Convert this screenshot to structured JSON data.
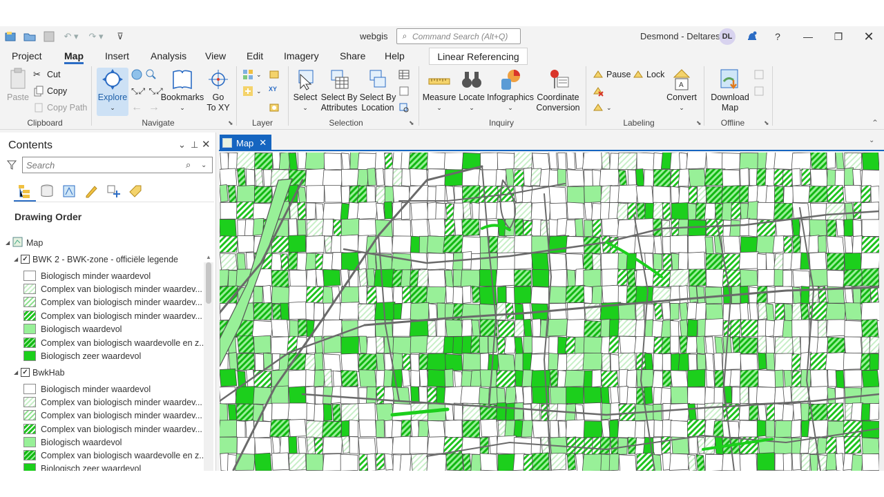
{
  "titlebar": {
    "app_title": "webgis",
    "command_search_placeholder": "Command Search (Alt+Q)",
    "user_name": "Desmond - Deltares",
    "avatar_initials": "DL",
    "help_label": "?"
  },
  "tabs": [
    "Project",
    "Map",
    "Insert",
    "Analysis",
    "View",
    "Edit",
    "Imagery",
    "Share",
    "Help"
  ],
  "contextual_tab": "Linear Referencing",
  "ribbon": {
    "clipboard": {
      "paste": "Paste",
      "cut": "Cut",
      "copy": "Copy",
      "copy_path": "Copy Path",
      "label": "Clipboard"
    },
    "navigate": {
      "explore": "Explore",
      "bookmarks": "Bookmarks",
      "go_to_xy_1": "Go",
      "go_to_xy_2": "To XY",
      "label": "Navigate"
    },
    "layer": {
      "label": "Layer"
    },
    "selection": {
      "select": "Select",
      "select_by_attributes_1": "Select By",
      "select_by_attributes_2": "Attributes",
      "select_by_location_1": "Select By",
      "select_by_location_2": "Location",
      "label": "Selection"
    },
    "inquiry": {
      "measure": "Measure",
      "locate": "Locate",
      "infographics": "Infographics",
      "coordinate_conversion_1": "Coordinate",
      "coordinate_conversion_2": "Conversion",
      "label": "Inquiry"
    },
    "labeling": {
      "pause": "Pause",
      "lock": "Lock",
      "convert": "Convert",
      "label": "Labeling"
    },
    "offline": {
      "download_map_1": "Download",
      "download_map_2": "Map",
      "label": "Offline"
    }
  },
  "contents": {
    "title": "Contents",
    "search_placeholder": "Search",
    "drawing_order": "Drawing Order",
    "map_node": "Map",
    "layers": [
      {
        "name": "BWK 2 - BWK-zone - officiële legende",
        "items": [
          "Biologisch minder waardevol",
          "Complex van biologisch minder waardev...",
          "Complex van biologisch minder waardev...",
          "Complex van biologisch minder waardev...",
          "Biologisch waardevol",
          "Complex van biologisch waardevolle en z...",
          "Biologisch zeer waardevol"
        ]
      },
      {
        "name": "BwkHab",
        "items": [
          "Biologisch minder waardevol",
          "Complex van biologisch minder waardev...",
          "Complex van biologisch minder waardev...",
          "Complex van biologisch minder waardev...",
          "Biologisch waardevol",
          "Complex van biologisch waardevolle en z...",
          "Biologisch zeer waardevol"
        ]
      }
    ]
  },
  "map_tab": "Map",
  "colors": {
    "accent": "#1565c0",
    "value_light_green": "#98f098",
    "value_green": "#1ccf1c",
    "road_gray": "#6a6a6a"
  }
}
